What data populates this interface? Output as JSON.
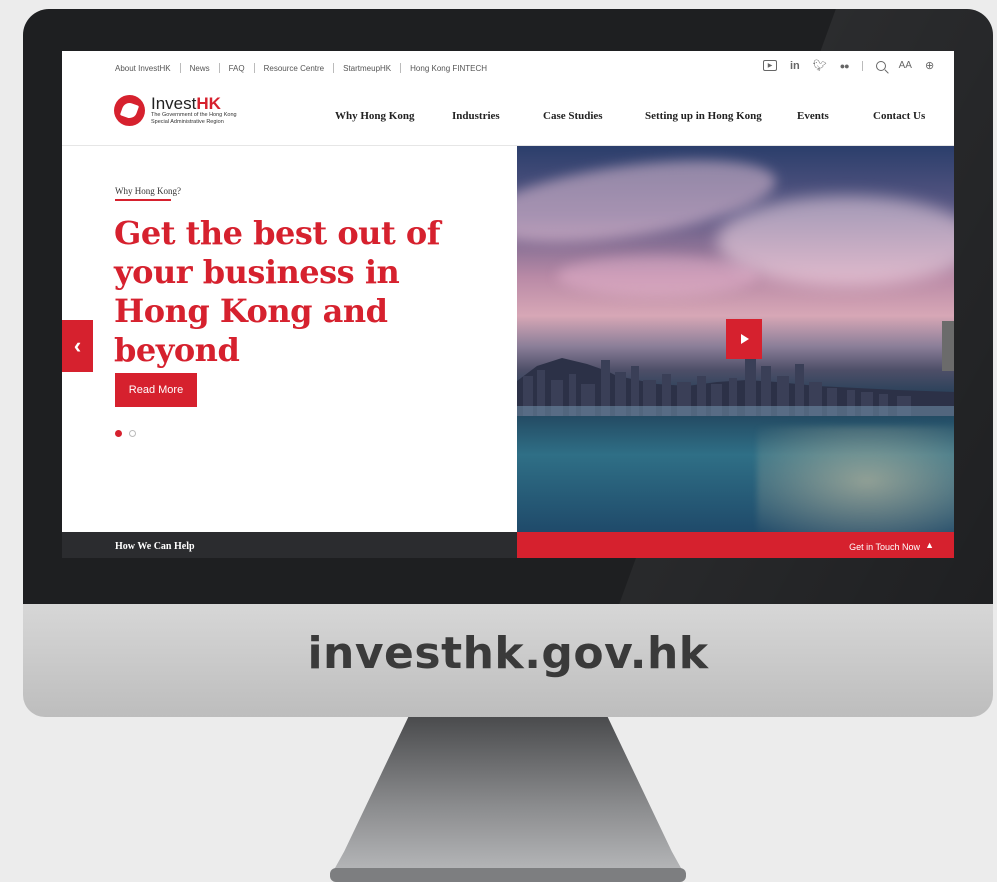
{
  "utility_links": [
    "About InvestHK",
    "News",
    "FAQ",
    "Resource Centre",
    "StartmeupHK",
    "Hong Kong FINTECH"
  ],
  "utility_icons": [
    "youtube-icon",
    "linkedin-icon",
    "twitter-icon",
    "flickr-icon",
    "search-icon",
    "font-size-icon",
    "globe-icon"
  ],
  "utility_labels": {
    "linkedin": "in",
    "font_size": "AA"
  },
  "logo": {
    "brand_prefix": "Invest",
    "brand_suffix": "HK",
    "subtitle_line1": "The Government of the Hong Kong",
    "subtitle_line2": "Special Administrative Region"
  },
  "nav": [
    "Why Hong Kong",
    "Industries",
    "Case Studies",
    "Setting up in Hong Kong",
    "Events",
    "Contact Us"
  ],
  "hero": {
    "eyebrow": "Why Hong Kong?",
    "headline": "Get the best out of your business in Hong Kong and beyond",
    "cta": "Read More",
    "slides_count": 2,
    "active_slide": 1
  },
  "bottom_bar": {
    "left": "How We Can Help",
    "right": "Get in Touch Now"
  },
  "monitor_caption": "investhk.gov.hk",
  "colors": {
    "brand_red": "#d6212e",
    "dark_bar": "#2b2c2f",
    "bezel": "#1e1f21"
  }
}
